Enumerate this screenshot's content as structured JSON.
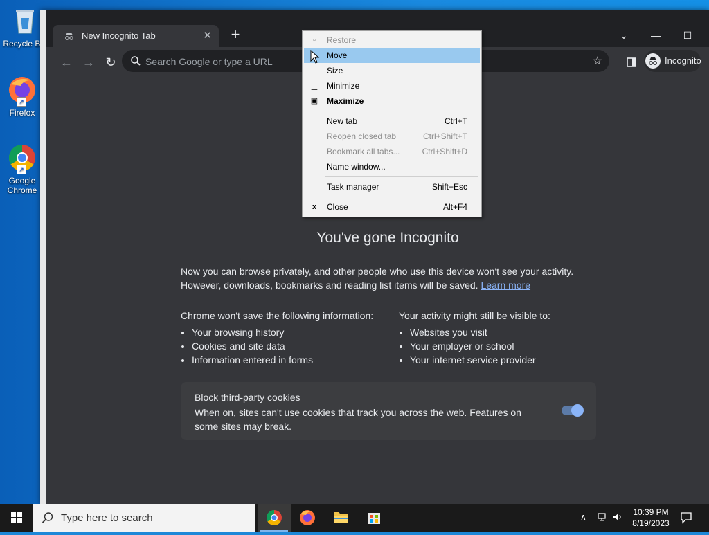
{
  "desktop": {
    "icons": [
      {
        "label": "Recycle Bin"
      },
      {
        "label": "Firefox"
      },
      {
        "label": "Google Chrome"
      }
    ]
  },
  "browser": {
    "tab_title": "New Incognito Tab",
    "omnibox_placeholder": "Search Google or type a URL",
    "profile_label": "Incognito"
  },
  "page": {
    "heading": "You've gone Incognito",
    "intro": "Now you can browse privately, and other people who use this device won't see your activity. However, downloads, bookmarks and reading list items will be saved.",
    "learn_more": "Learn more",
    "left_title": "Chrome won't save the following information:",
    "left_items": [
      "Your browsing history",
      "Cookies and site data",
      "Information entered in forms"
    ],
    "right_title": "Your activity might still be visible to:",
    "right_items": [
      "Websites you visit",
      "Your employer or school",
      "Your internet service provider"
    ],
    "cookies_title": "Block third-party cookies",
    "cookies_desc": "When on, sites can't use cookies that track you across the web. Features on some sites may break.",
    "cookies_enabled": true
  },
  "context_menu": {
    "items": [
      {
        "label": "Restore",
        "shortcut": "",
        "disabled": true
      },
      {
        "label": "Move",
        "shortcut": "",
        "highlighted": true
      },
      {
        "label": "Size",
        "shortcut": ""
      },
      {
        "label": "Minimize",
        "shortcut": ""
      },
      {
        "label": "Maximize",
        "shortcut": "",
        "bold": true
      },
      {
        "label": "New tab",
        "shortcut": "Ctrl+T"
      },
      {
        "label": "Reopen closed tab",
        "shortcut": "Ctrl+Shift+T",
        "disabled": true
      },
      {
        "label": "Bookmark all tabs...",
        "shortcut": "Ctrl+Shift+D",
        "disabled": true
      },
      {
        "label": "Name window...",
        "shortcut": ""
      },
      {
        "label": "Task manager",
        "shortcut": "Shift+Esc"
      },
      {
        "label": "Close",
        "shortcut": "Alt+F4"
      }
    ]
  },
  "taskbar": {
    "search_placeholder": "Type here to search",
    "time": "10:39 PM",
    "date": "8/19/2023"
  },
  "colors": {
    "accent": "#8ab4f8",
    "menu_highlight": "#99c9ef"
  }
}
